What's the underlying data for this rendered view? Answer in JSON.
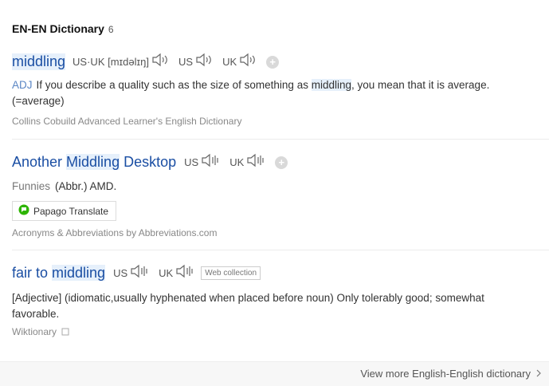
{
  "header": {
    "title": "EN-EN Dictionary",
    "count": "6"
  },
  "entries": [
    {
      "word": "middling",
      "pron_label": "US·UK [mɪdəlɪŋ]",
      "us": "US",
      "uk": "UK",
      "pos": "ADJ",
      "def_pre": "If you describe a quality such as the size of something as ",
      "def_hl": "middling",
      "def_post": ", you mean that it is average.",
      "def_line2": "(=average)",
      "source": "Collins Cobuild Advanced Learner's English Dictionary"
    },
    {
      "word_pre": "Another ",
      "word_hl": "Middling",
      "word_post": " Desktop",
      "us": "US",
      "uk": "UK",
      "category": "Funnies",
      "def": "(Abbr.) AMD.",
      "papago": "Papago Translate",
      "source": "Acronyms & Abbreviations by Abbreviations.com"
    },
    {
      "word_pre": "fair to ",
      "word_hl": "middling",
      "us": "US",
      "uk": "UK",
      "tag": "Web collection",
      "def_line1": "[Adjective] (idiomatic,usually hyphenated when placed before noun) Only tolerably good; somewhat",
      "def_line2": "favorable.",
      "source": "Wiktionary"
    }
  ],
  "footer": {
    "more": "View more English-English dictionary"
  }
}
